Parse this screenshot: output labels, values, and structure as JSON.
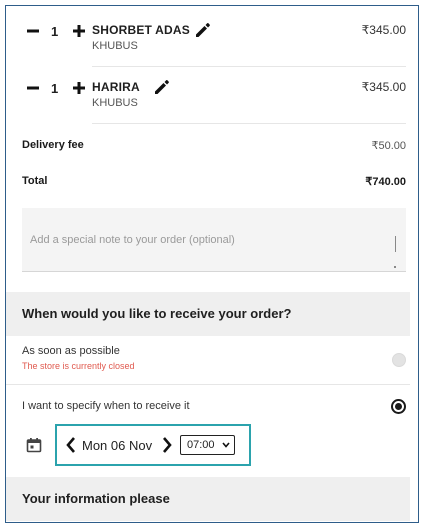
{
  "cart": {
    "items": [
      {
        "qty": "1",
        "name": "SHORBET ADAS",
        "variant": "KHUBUS",
        "price": "₹345.00"
      },
      {
        "qty": "1",
        "name": "HARIRA",
        "variant": "KHUBUS",
        "price": "₹345.00"
      }
    ],
    "delivery_label": "Delivery fee",
    "delivery_value": "₹50.00",
    "total_label": "Total",
    "total_value": "₹740.00",
    "note_placeholder": "Add a special note to your order (optional)"
  },
  "delivery_time": {
    "heading": "When would you like to receive your order?",
    "option_asap": {
      "title": "As soon as possible",
      "subtitle": "The store is currently closed",
      "selected": false
    },
    "option_specify": {
      "title": "I want to specify when to receive it",
      "selected": true
    },
    "date": "Mon 06 Nov",
    "time": "07:00"
  },
  "info": {
    "heading": "Your information please"
  },
  "colors": {
    "highlight_border": "#2ba3ad",
    "closed_text": "#e05a4f",
    "frame_border": "#2e5d8a"
  },
  "icons": [
    "minus-icon",
    "plus-icon",
    "pencil-icon",
    "calendar-icon",
    "chevron-left-icon",
    "chevron-right-icon",
    "chevron-down-icon"
  ]
}
